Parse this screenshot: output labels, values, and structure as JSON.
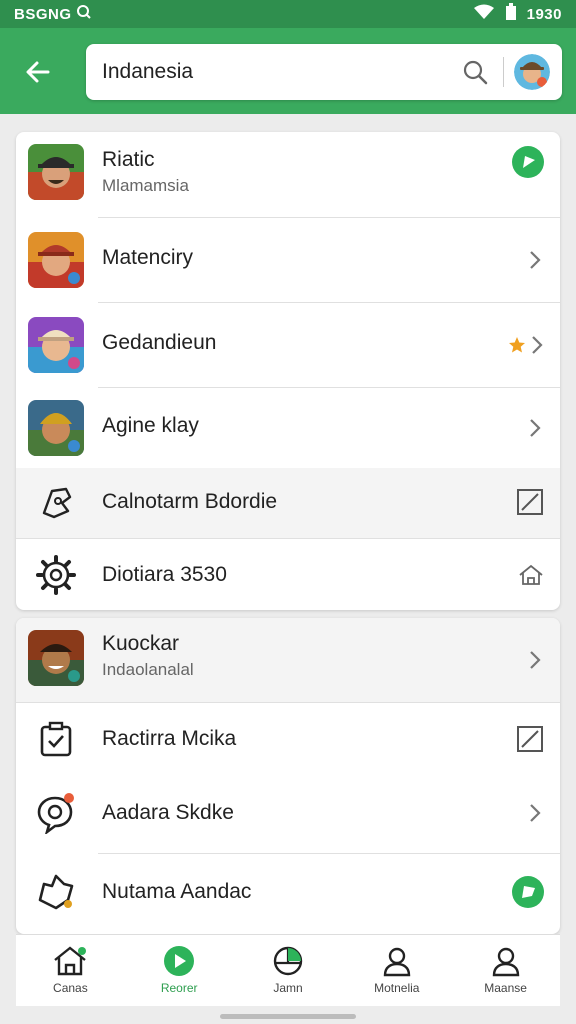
{
  "status_bar": {
    "time_left": "BSGNG",
    "time_right": "1930"
  },
  "search": {
    "query": "Indanesia"
  },
  "list_primary": [
    {
      "title": "Riatic",
      "subtitle": "Mlamamsia",
      "trailing": "green-play-icon"
    },
    {
      "title": "Matenciry",
      "trailing": "chevron-right-icon"
    },
    {
      "title": "Gedandieun",
      "trailing": "star-chevron"
    },
    {
      "title": "Agine klay",
      "trailing": "chevron-right-icon"
    },
    {
      "title": "Calnotarm Bdordie",
      "trailing": "edit-square-icon"
    },
    {
      "title": "Diotiara 3530",
      "trailing": "home-outline-icon"
    }
  ],
  "list_secondary": [
    {
      "title": "Kuockar",
      "subtitle": "Indaolanalal",
      "trailing": "chevron-right-icon"
    },
    {
      "title": "Ractirra Mcika",
      "trailing": "edit-square-icon"
    },
    {
      "title": "Aadara Skdke",
      "trailing": "chevron-right-icon"
    },
    {
      "title": "Nutama Aandac",
      "trailing": "green-chat-icon"
    }
  ],
  "bottom_nav": [
    {
      "label": "Canas",
      "icon": "home-icon"
    },
    {
      "label": "Reorer",
      "icon": "play-circle-icon",
      "active": true
    },
    {
      "label": "Jamn",
      "icon": "globe-icon"
    },
    {
      "label": "Motnelia",
      "icon": "user-icon"
    },
    {
      "label": "Maanse",
      "icon": "profile-icon"
    }
  ],
  "colors": {
    "primary": "#3aaa5e",
    "status_bar": "#2f8f4e",
    "accent_star": "#f0a020"
  }
}
